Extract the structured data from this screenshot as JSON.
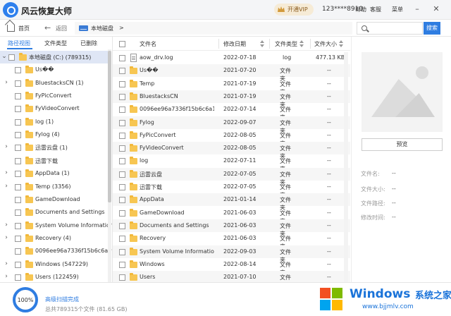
{
  "app": {
    "title": "风云恢复大师",
    "vip_label": "开通VIP",
    "user": "123****8910",
    "help": "帮助",
    "support": "客服",
    "menu": "菜单"
  },
  "nav": {
    "home": "首页",
    "back": "返回",
    "path": "本地磁盘",
    "path_sep": ">",
    "search_placeholder": "",
    "search_btn": "搜索"
  },
  "left": {
    "tabs": [
      "路径视图",
      "文件类型",
      "已删除"
    ],
    "tree": [
      {
        "label": "本地磁盘 (C:) (789315)",
        "kind": "drive",
        "expanded": true
      },
      {
        "label": "Us��",
        "kind": "folder",
        "arrow": false
      },
      {
        "label": "BluestacksCN (1)",
        "kind": "folder",
        "arrow": true
      },
      {
        "label": "FyPicConvert",
        "kind": "folder",
        "arrow": false
      },
      {
        "label": "FyVideoConvert",
        "kind": "folder",
        "arrow": false
      },
      {
        "label": "log (1)",
        "kind": "folder",
        "arrow": false
      },
      {
        "label": "Fylog (4)",
        "kind": "folder",
        "arrow": false
      },
      {
        "label": "迅雷云盘 (1)",
        "kind": "folder",
        "arrow": true
      },
      {
        "label": "迅雷下载",
        "kind": "folder",
        "arrow": false
      },
      {
        "label": "AppData (1)",
        "kind": "folder",
        "arrow": true
      },
      {
        "label": "Temp (3356)",
        "kind": "folder",
        "arrow": true
      },
      {
        "label": "GameDownload",
        "kind": "folder",
        "arrow": false
      },
      {
        "label": "Documents and Settings",
        "kind": "folder",
        "arrow": false
      },
      {
        "label": "System Volume Information (",
        "kind": "folder",
        "arrow": true
      },
      {
        "label": "Recovery (4)",
        "kind": "folder",
        "arrow": true
      },
      {
        "label": "0096ee96a7336f15b6c6a1938",
        "kind": "folder",
        "arrow": false
      },
      {
        "label": "Windows (547229)",
        "kind": "folder",
        "arrow": true
      },
      {
        "label": "Users (122459)",
        "kind": "folder",
        "arrow": true
      }
    ]
  },
  "files": {
    "headers": {
      "name": "文件名",
      "date": "修改日期",
      "type": "文件类型",
      "size": "文件大小"
    },
    "rows": [
      {
        "name": "aow_drv.log",
        "date": "2022-07-18",
        "type": "log",
        "size": "477.13 KB",
        "kind": "file"
      },
      {
        "name": "Us��",
        "date": "2021-07-20",
        "type": "文件夹",
        "size": "--",
        "kind": "folder"
      },
      {
        "name": "Temp",
        "date": "2021-07-19",
        "type": "文件夹",
        "size": "--",
        "kind": "folder"
      },
      {
        "name": "BluestacksCN",
        "date": "2021-07-19",
        "type": "文件夹",
        "size": "--",
        "kind": "folder"
      },
      {
        "name": "0096ee96a7336f15b6c6a1...",
        "date": "2022-07-14",
        "type": "文件夹",
        "size": "--",
        "kind": "folder"
      },
      {
        "name": "Fylog",
        "date": "2022-09-07",
        "type": "文件夹",
        "size": "--",
        "kind": "folder"
      },
      {
        "name": "FyPicConvert",
        "date": "2022-08-05",
        "type": "文件夹",
        "size": "--",
        "kind": "folder"
      },
      {
        "name": "FyVideoConvert",
        "date": "2022-08-05",
        "type": "文件夹",
        "size": "--",
        "kind": "folder"
      },
      {
        "name": "log",
        "date": "2022-07-11",
        "type": "文件夹",
        "size": "--",
        "kind": "folder"
      },
      {
        "name": "迅雷云盘",
        "date": "2022-07-05",
        "type": "文件夹",
        "size": "--",
        "kind": "folder"
      },
      {
        "name": "迅雷下载",
        "date": "2022-07-05",
        "type": "文件夹",
        "size": "--",
        "kind": "folder"
      },
      {
        "name": "AppData",
        "date": "2021-01-14",
        "type": "文件夹",
        "size": "--",
        "kind": "folder"
      },
      {
        "name": "GameDownload",
        "date": "2021-06-03",
        "type": "文件夹",
        "size": "--",
        "kind": "folder"
      },
      {
        "name": "Documents and Settings",
        "date": "2021-06-03",
        "type": "文件夹",
        "size": "--",
        "kind": "folder"
      },
      {
        "name": "Recovery",
        "date": "2021-06-03",
        "type": "文件夹",
        "size": "--",
        "kind": "folder"
      },
      {
        "name": "System Volume Information",
        "date": "2022-09-03",
        "type": "文件夹",
        "size": "--",
        "kind": "folder"
      },
      {
        "name": "Windows",
        "date": "2022-08-14",
        "type": "文件夹",
        "size": "--",
        "kind": "folder"
      },
      {
        "name": "Users",
        "date": "2021-07-10",
        "type": "文件夹",
        "size": "--",
        "kind": "folder"
      }
    ]
  },
  "preview": {
    "button": "预览",
    "meta": [
      {
        "label": "文件名:",
        "value": "--"
      },
      {
        "label": "文件大小:",
        "value": "--"
      },
      {
        "label": "文件路径:",
        "value": "--"
      },
      {
        "label": "修改时间:",
        "value": "--"
      }
    ]
  },
  "status": {
    "progress_text": "100%",
    "progress": 100,
    "title": "高级扫描完成",
    "summary": "总共789315个文件 (81.65 GB)"
  },
  "watermark": {
    "brand": "Windows",
    "cn": "系统之家",
    "url": "www.bjjmlv.com"
  },
  "colors": {
    "accent": "#2f7de1",
    "vip": "#f6ebd6",
    "folder": "#f7c652"
  }
}
